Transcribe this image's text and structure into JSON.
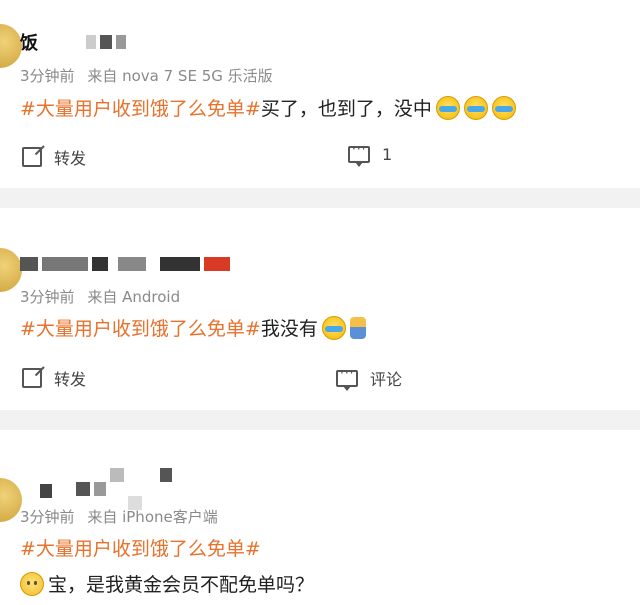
{
  "colors": {
    "tag": "#e8712b",
    "meta": "#8a8a8a",
    "separator": "#f2f2f2"
  },
  "posts": [
    {
      "name": "饭",
      "time": "3分钟前",
      "source": "来自 nova 7 SE 5G 乐活版",
      "hashtag": "#大量用户收到饿了么免单#",
      "text": "买了，也到了，没中",
      "emojis": [
        "cry-laugh-emoji",
        "cry-laugh-emoji",
        "cry-laugh-emoji"
      ],
      "actions": {
        "repost_label": "转发",
        "comment_count": "1"
      }
    },
    {
      "name": "",
      "time": "3分钟前",
      "source": "来自 Android",
      "hashtag": "#大量用户收到饿了么免单#",
      "text": "我没有",
      "emojis": [
        "crying-emoji",
        "kid-emoji"
      ],
      "actions": {
        "repost_label": "转发",
        "comment_label": "评论"
      }
    },
    {
      "name": "",
      "time": "3分钟前",
      "source": "来自 iPhone客户端",
      "hashtag": "#大量用户收到饿了么免单#",
      "text": "宝，是我黄金会员不配免单吗？",
      "emojis": [
        "pleading-emoji"
      ]
    }
  ]
}
